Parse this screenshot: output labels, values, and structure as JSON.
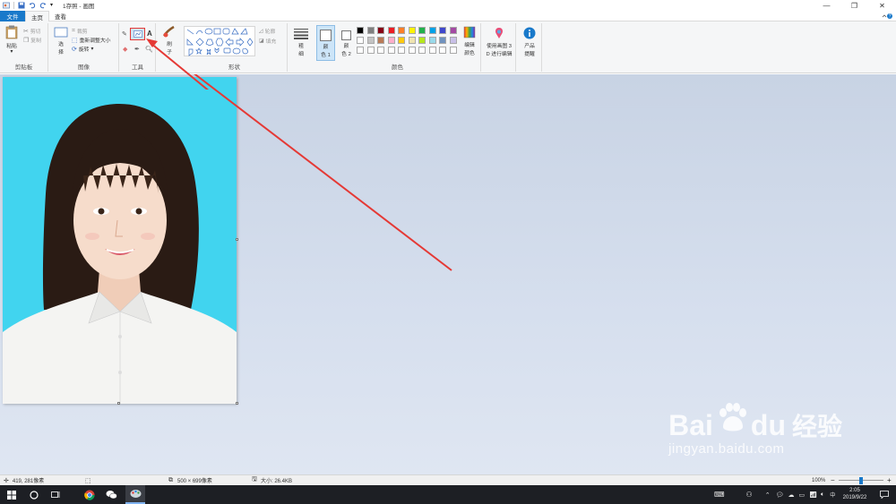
{
  "window": {
    "title": "1存照 - 画图",
    "minimize": "—",
    "maximize": "❐",
    "close": "✕"
  },
  "tabs": [
    {
      "label": "文件"
    },
    {
      "label": "主页"
    },
    {
      "label": "查看"
    }
  ],
  "help_icon": "help-icon",
  "ribbon": {
    "clipboard": {
      "paste_label": "粘贴",
      "cut_label": "剪切",
      "copy_label": "复制",
      "group_label": "剪贴板"
    },
    "image": {
      "select_label_1": "选",
      "select_label_2": "择",
      "crop_label": "裁剪",
      "resize_label": "重新调整大小",
      "rotate_label": "旋转",
      "group_label": "图像"
    },
    "tools": {
      "group_label": "工具",
      "brush_label": "刷",
      "brush_label_2": "子"
    },
    "shapes": {
      "outline_label": "轮廓",
      "fill_label": "填充",
      "group_label": "形状"
    },
    "size_label_1": "粗",
    "size_label_2": "细",
    "colors": {
      "color1_label_1": "颜",
      "color1_label_2": "色 1",
      "color2_label_1": "颜",
      "color2_label_2": "色 2",
      "edit_label_1": "编辑",
      "edit_label_2": "颜色",
      "group_label": "颜色",
      "palette_row1": [
        "#000000",
        "#7f7f7f",
        "#880015",
        "#ed1c24",
        "#ff7f27",
        "#fff200",
        "#22b14c",
        "#00a2e8",
        "#3f48cc",
        "#a349a4"
      ],
      "palette_row2": [
        "#ffffff",
        "#c3c3c3",
        "#b97a57",
        "#ffaec9",
        "#ffc90e",
        "#efe4b0",
        "#b5e61d",
        "#99d9ea",
        "#7092be",
        "#c8bfe7"
      ]
    },
    "paint3d_label_1": "使用画图 3",
    "paint3d_label_2": "D 进行编辑",
    "product_label_1": "产品",
    "product_label_2": "提醒"
  },
  "status": {
    "cursor_pos": "419, 281像素",
    "image_size": "500 × 699像素",
    "file_size": "大小: 26.4KB",
    "zoom": "100%"
  },
  "taskbar": {
    "time": "2:05",
    "date": "2019/9/22",
    "ime": "中"
  },
  "watermark": {
    "brand": "Bai",
    "brand2": "du",
    "cn": "经验",
    "url": "jingyan.baidu.com"
  }
}
